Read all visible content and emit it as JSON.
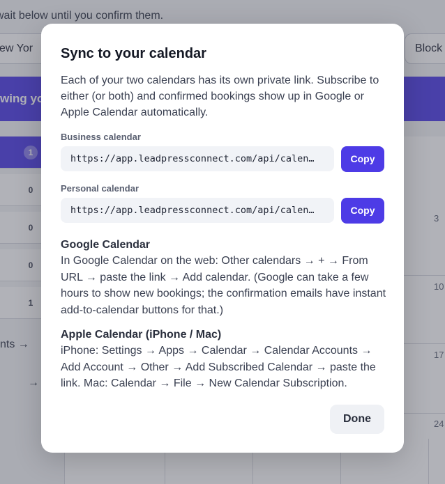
{
  "background": {
    "note": "wait below until you confirm them.",
    "select_value": "ew Yor",
    "block_button": "Block",
    "banner_text": "wing you",
    "list_badges": [
      "1",
      "0",
      "0",
      "0",
      "1"
    ],
    "nav_items": [
      "nts →",
      "→"
    ],
    "calendar_days": [
      "3",
      "10",
      "17",
      "24"
    ]
  },
  "modal": {
    "title": "Sync to your calendar",
    "description": "Each of your two calendars has its own private link. Subscribe to either (or both) and confirmed bookings show up in Google or Apple Calendar automatically.",
    "business": {
      "label": "Business calendar",
      "url": "https://app.leadpressconnect.com/api/calen…",
      "copy_label": "Copy"
    },
    "personal": {
      "label": "Personal calendar",
      "url": "https://app.leadpressconnect.com/api/calen…",
      "copy_label": "Copy"
    },
    "google": {
      "title": "Google Calendar",
      "body": "In Google Calendar on the web: Other calendars → + → From URL → paste the link → Add calendar. (Google can take a few hours to show new bookings; the confirmation emails have instant add-to-calendar buttons for that.)"
    },
    "apple": {
      "title": "Apple Calendar (iPhone / Mac)",
      "body": "iPhone: Settings → Apps → Calendar → Calendar Accounts → Add Account → Other → Add Subscribed Calendar → paste the link. Mac: Calendar → File → New Calendar Subscription."
    },
    "done_label": "Done"
  },
  "colors": {
    "accent": "#4d3be6",
    "overlay": "#464856"
  }
}
